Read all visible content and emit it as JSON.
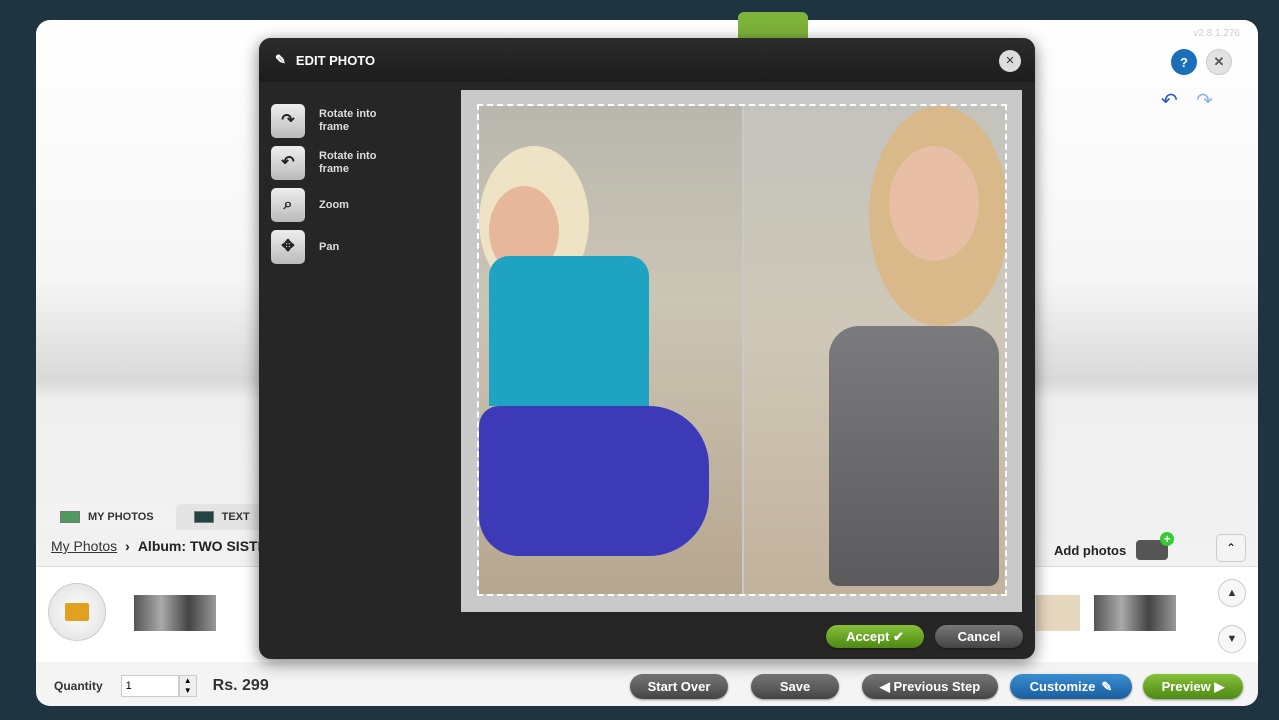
{
  "app": {
    "version": "v2.8.1.276",
    "help": "?",
    "close": "✕",
    "undo": "↶",
    "redo": "↷"
  },
  "tabs": [
    {
      "label": "MY PHOTOS"
    },
    {
      "label": "TEXT"
    }
  ],
  "breadcrumb": {
    "root": "My Photos",
    "sep": "›",
    "album": "Album: TWO SISTERS TOGETHER"
  },
  "add_photos": "Add photos",
  "collapse": "⌃",
  "scroll": {
    "up": "▲",
    "down": "▼"
  },
  "bottom": {
    "quantity_label": "Quantity",
    "quantity_value": "1",
    "spin_up": "▲",
    "spin_down": "▼",
    "price": "Rs. 299",
    "start_over": "Start Over",
    "save": "Save",
    "previous": "◀ Previous Step",
    "customize": "Customize",
    "preview": "Preview ▶"
  },
  "modal": {
    "title": "EDIT PHOTO",
    "close": "✕",
    "tools": [
      {
        "label": "Rotate into frame",
        "icon": "↷"
      },
      {
        "label": "Rotate into frame",
        "icon": "↶"
      },
      {
        "label": "Zoom",
        "icon": "⌕"
      },
      {
        "label": "Pan",
        "icon": "✥"
      }
    ],
    "accept": "Accept ✔",
    "cancel": "Cancel"
  },
  "colors": {
    "green": "#7db33a",
    "blue": "#1b6fb8",
    "modal": "#262626"
  }
}
